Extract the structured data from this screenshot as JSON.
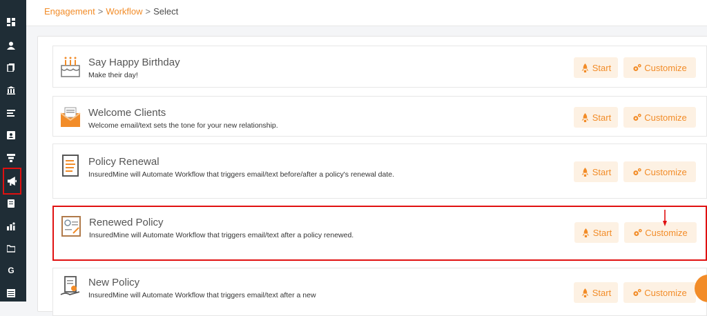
{
  "sidebar": {
    "items": [
      {
        "name": "dashboard-icon"
      },
      {
        "name": "contacts-icon"
      },
      {
        "name": "documents-icon"
      },
      {
        "name": "bank-icon"
      },
      {
        "name": "list-icon"
      },
      {
        "name": "profile-card-icon"
      },
      {
        "name": "filter-icon"
      },
      {
        "name": "megaphone-icon",
        "active": true
      },
      {
        "name": "file-icon"
      },
      {
        "name": "people-icon"
      },
      {
        "name": "folder-icon"
      },
      {
        "name": "google-icon",
        "glyph": "G"
      },
      {
        "name": "table-icon"
      }
    ]
  },
  "breadcrumb": {
    "items": [
      "Engagement",
      "Workflow",
      "Select"
    ],
    "separator": ">"
  },
  "workflows": [
    {
      "title": "Say Happy Birthday",
      "desc": "Make their day!",
      "icon": "birthday-cake-icon"
    },
    {
      "title": "Welcome Clients",
      "desc": "Welcome email/text sets the tone for your new relationship.",
      "icon": "envelope-icon"
    },
    {
      "title": "Policy Renewal",
      "desc": "InsuredMine will Automate Workflow that triggers email/text before/after a policy's renewal date.",
      "icon": "document-icon"
    },
    {
      "title": "Renewed Policy",
      "desc": "InsuredMine will Automate Workflow that triggers email/text after a policy renewed.",
      "icon": "certificate-icon"
    },
    {
      "title": "New Policy",
      "desc": "InsuredMine will Automate Workflow that triggers email/text after a new",
      "icon": "policy-hand-icon"
    }
  ],
  "buttons": {
    "start": "Start",
    "customize": "Customize"
  },
  "colors": {
    "accent": "#f28c28",
    "highlight": "#e01010",
    "sidebar": "#1f2d36"
  }
}
